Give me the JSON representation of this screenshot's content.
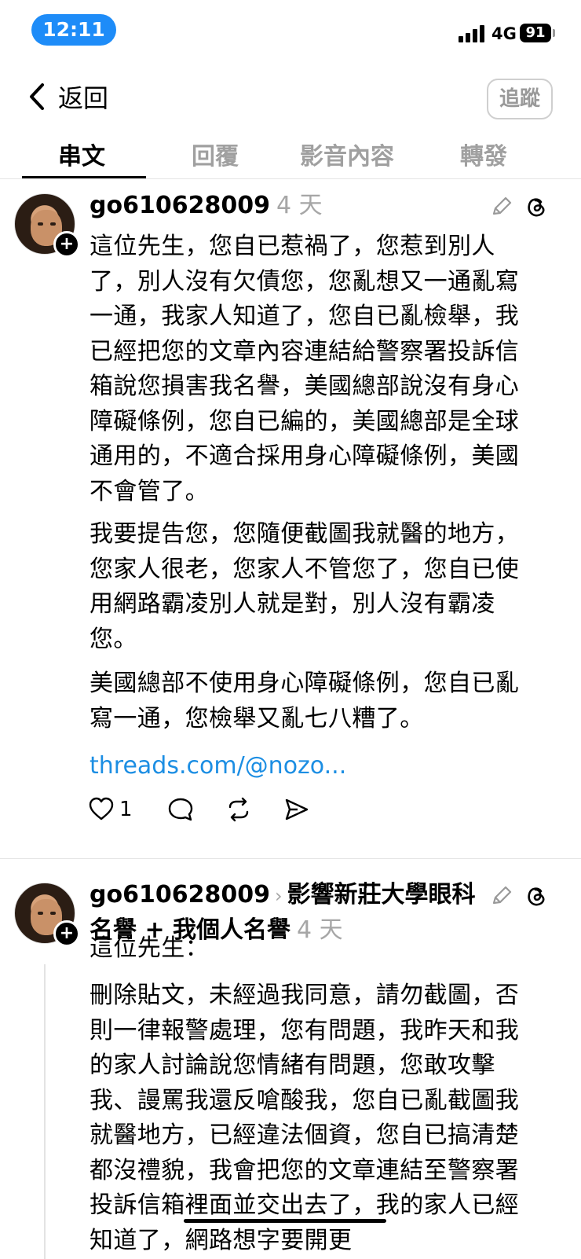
{
  "status_bar": {
    "time": "12:11",
    "network": "4G",
    "battery": "91"
  },
  "header": {
    "back_label": "返回",
    "follow_label": "追蹤"
  },
  "tabs": [
    {
      "label": "串文",
      "active": true
    },
    {
      "label": "回覆",
      "active": false
    },
    {
      "label": "影音內容",
      "active": false
    },
    {
      "label": "轉發",
      "active": false
    }
  ],
  "posts": [
    {
      "username": "go610628009",
      "age": "4 天",
      "paragraphs": [
        "這位先生，您自已惹禍了，您惹到別人了，別人沒有欠債您，您亂想又一通亂寫一通，我家人知道了，您自已亂檢舉，我已經把您的文章內容連結給警察署投訴信箱說您損害我名譽，美國總部說沒有身心障礙條例，您自已編的，美國總部是全球通用的，不適合採用身心障礙條例，美國不會管了。",
        "我要提告您，您隨便截圖我就醫的地方，您家人很老，您家人不管您了，您自已使用網路霸凌別人就是對，別人沒有霸凌您。",
        "美國總部不使用身心障礙條例，您自已亂寫一通，您檢舉又亂七八糟了。"
      ],
      "link": "threads.com/@nozo...",
      "likes": "1"
    },
    {
      "username": "go610628009",
      "topic": "影響新莊大學眼科名譽 + 我個人名譽",
      "age": "4 天",
      "paragraphs": [
        "這位先生：",
        "刪除貼文，未經過我同意，請勿截圖，否則一律報警處理，您有問題，我昨天和我的家人討論說您情緒有問題，您敢攻擊我、謾罵我還反嗆酸我，您自已亂截圖我就醫地方，已經違法個資，您自已搞清楚都沒禮貌，我會把您的文章連結至警察署投訴信箱裡面並交出去了，我的家人已經知道了，網路想字要開更"
      ]
    }
  ],
  "colors": {
    "accent_blue": "#1e8cf8",
    "link_blue": "#1c8ee3",
    "muted_gray": "#a0a0a0"
  }
}
